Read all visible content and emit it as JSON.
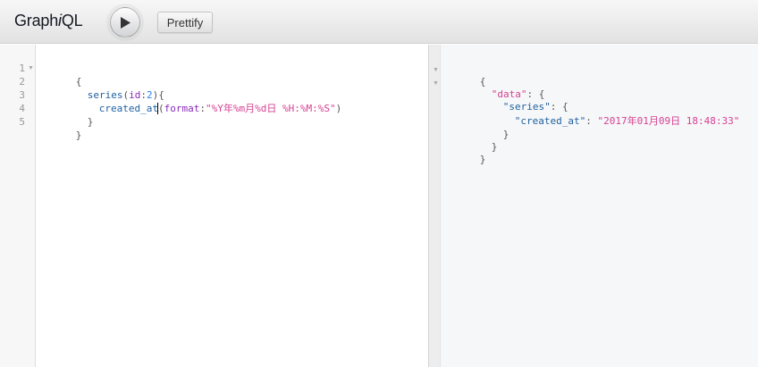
{
  "toolbar": {
    "title_prefix": "Graph",
    "title_italic": "i",
    "title_suffix": "QL",
    "prettify_label": "Prettify"
  },
  "query": {
    "line_numbers": [
      "1",
      "2",
      "3",
      "4",
      "5"
    ],
    "line1": "{",
    "line2_field": "series",
    "line2_open": "(",
    "line2_arg": "id",
    "line2_colon": ":",
    "line2_value": "2",
    "line2_close": "){",
    "line3_field": "created_at",
    "line3_open": "(",
    "line3_arg": "format",
    "line3_colon": ":",
    "line3_value": "\"%Y年%m月%d日 %H:%M:%S\"",
    "line3_close": ")",
    "line4": "}",
    "line5": "}"
  },
  "result": {
    "line1": "{",
    "data_key": "\"data\"",
    "colon_brace": ": {",
    "series_key": "\"series\"",
    "created_at_key": "\"created_at\"",
    "colon": ": ",
    "created_at_value": "\"2017年01月09日 18:48:33\"",
    "close": "}"
  }
}
